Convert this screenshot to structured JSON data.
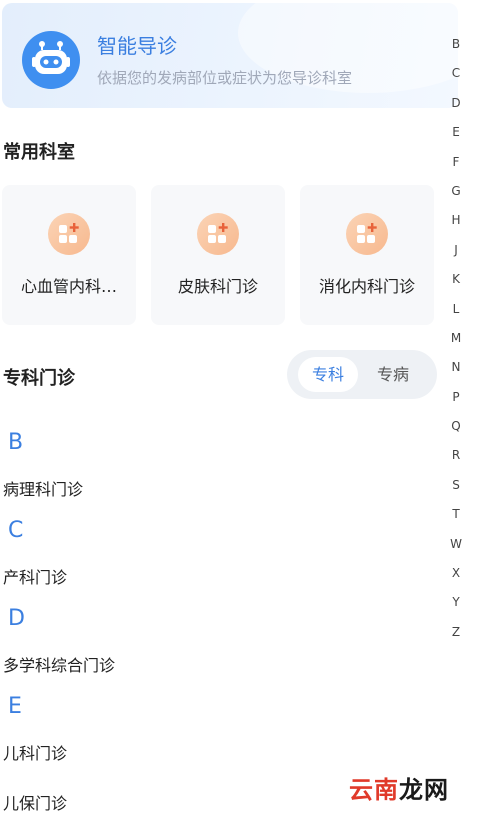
{
  "guide": {
    "title": "智能导诊",
    "subtitle": "依据您的发病部位或症状为您导诊科室",
    "icon": "robot-icon"
  },
  "common_departments": {
    "title": "常用科室",
    "items": [
      {
        "label": "心血管内科…",
        "icon": "department-icon"
      },
      {
        "label": "皮肤科门诊",
        "icon": "department-icon"
      },
      {
        "label": "消化内科门诊",
        "icon": "department-icon"
      }
    ]
  },
  "specialty": {
    "title": "专科门诊",
    "tabs": [
      {
        "label": "专科",
        "active": true
      },
      {
        "label": "专病",
        "active": false
      }
    ],
    "groups": [
      {
        "letter": "B",
        "items": [
          "病理科门诊"
        ]
      },
      {
        "letter": "C",
        "items": [
          "产科门诊"
        ]
      },
      {
        "letter": "D",
        "items": [
          "多学科综合门诊"
        ]
      },
      {
        "letter": "E",
        "items": [
          "儿科门诊",
          "儿保门诊"
        ]
      }
    ]
  },
  "alphabet_index": [
    "B",
    "C",
    "D",
    "E",
    "F",
    "G",
    "H",
    "J",
    "K",
    "L",
    "M",
    "N",
    "P",
    "Q",
    "R",
    "S",
    "T",
    "W",
    "X",
    "Y",
    "Z"
  ],
  "watermark": {
    "part1": "云南",
    "part2": "龙网"
  },
  "colors": {
    "accent": "#3b7fe0",
    "icon_orange": "#f7b88e",
    "card_bg": "#f7f8fa"
  }
}
